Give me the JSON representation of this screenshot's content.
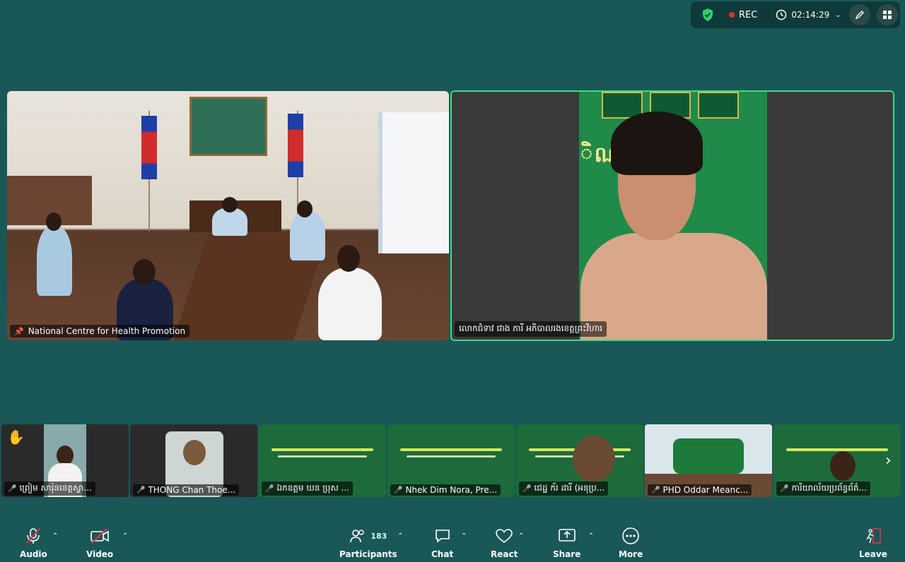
{
  "topbar": {
    "rec_label": "REC",
    "timer": "02:14:29"
  },
  "main": {
    "room_name": "National Centre for Health Promotion",
    "speaker_name": "លោកជំទាវ ជាង ភារី អភិបាលរងខេត្តព្រះវិហារ",
    "speaker_wall_text": "ិណ ​ ព្រះវិ"
  },
  "strip": [
    {
      "label": "ព្រៀម សារ៉ុនខេត្តស្វា...",
      "raised_hand": true
    },
    {
      "label": "THONG Chan Thoe..."
    },
    {
      "label": "ឯកឧត្តម ឃន ប្រុស ..."
    },
    {
      "label": "Nhek Dim Nora, Pre..."
    },
    {
      "label": "ជេដ្ឋ ក័រ ដារី (អនុប្រ..."
    },
    {
      "label": "PHD Oddar Meanc..."
    },
    {
      "label": "ការិយាល័យប្រព័ន្ធព័ត៌..."
    }
  ],
  "toolbar": {
    "audio": "Audio",
    "video": "Video",
    "participants": "Participants",
    "participants_count": "183",
    "chat": "Chat",
    "react": "React",
    "share": "Share",
    "more": "More",
    "leave": "Leave"
  },
  "colors": {
    "background": "#1a5757",
    "active_speaker_border": "#3ddc84",
    "rec_dot": "#e03131",
    "shield": "#2fcf6a",
    "leave": "#e0334a"
  }
}
